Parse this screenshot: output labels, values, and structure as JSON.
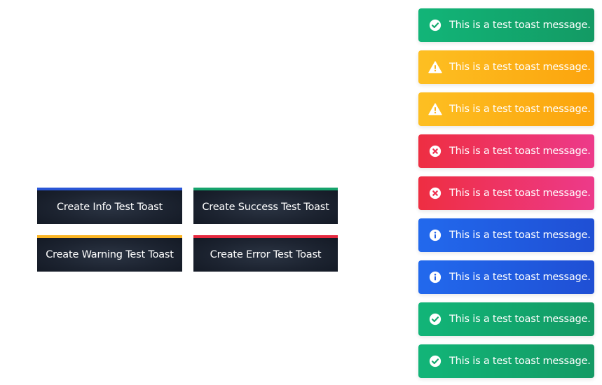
{
  "buttons": [
    {
      "label": "Create Info Test Toast",
      "accent": "#2a56d6"
    },
    {
      "label": "Create Success Test Toast",
      "accent": "#16a36c"
    },
    {
      "label": "Create Warning Test Toast",
      "accent": "#fbb524"
    },
    {
      "label": "Create Error Test Toast",
      "accent": "#e5293f"
    }
  ],
  "toasts": [
    {
      "type": "success",
      "icon": "check-circle-icon",
      "message": "This is a test toast message."
    },
    {
      "type": "warning",
      "icon": "warning-triangle-icon",
      "message": "This is a test toast message."
    },
    {
      "type": "warning",
      "icon": "warning-triangle-icon",
      "message": "This is a test toast message."
    },
    {
      "type": "error",
      "icon": "x-circle-icon",
      "message": "This is a test toast message."
    },
    {
      "type": "error",
      "icon": "x-circle-icon",
      "message": "This is a test toast message."
    },
    {
      "type": "info",
      "icon": "info-circle-icon",
      "message": "This is a test toast message."
    },
    {
      "type": "info",
      "icon": "info-circle-icon",
      "message": "This is a test toast message."
    },
    {
      "type": "success",
      "icon": "check-circle-icon",
      "message": "This is a test toast message."
    },
    {
      "type": "success",
      "icon": "check-circle-icon",
      "message": "This is a test toast message."
    }
  ]
}
